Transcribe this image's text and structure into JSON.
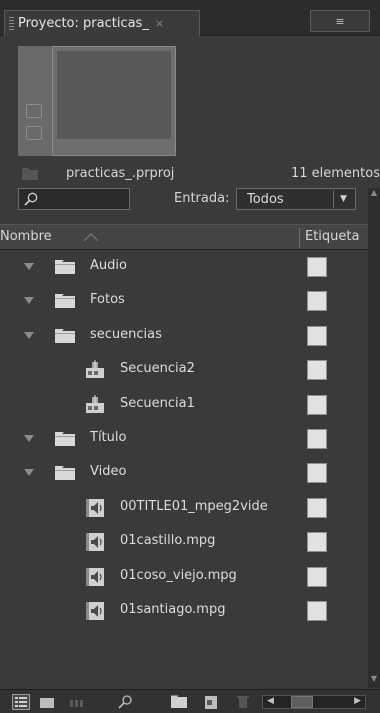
{
  "panel": {
    "tab_title": "Proyecto: practicas_",
    "tab_close": "×",
    "menu_icon": "≡"
  },
  "project": {
    "name": "practicas_.prproj",
    "item_count": "11 elementos"
  },
  "filter": {
    "search_placeholder": "",
    "entrada_label": "Entrada:",
    "entrada_value": "Todos"
  },
  "columns": {
    "name": "Nombre",
    "label": "Etiqueta"
  },
  "items": [
    {
      "type": "folder",
      "label": "Audio"
    },
    {
      "type": "folder",
      "label": "Fotos"
    },
    {
      "type": "folder",
      "label": "secuencias"
    },
    {
      "type": "sequence",
      "label": "Secuencia2"
    },
    {
      "type": "sequence",
      "label": "Secuencia1"
    },
    {
      "type": "folder",
      "label": "Título"
    },
    {
      "type": "folder",
      "label": "Video"
    },
    {
      "type": "clip",
      "label": "00TITLE01_mpeg2vide"
    },
    {
      "type": "clip",
      "label": "01castillo.mpg"
    },
    {
      "type": "clip",
      "label": "01coso_viejo.mpg"
    },
    {
      "type": "clip",
      "label": "01santiago.mpg"
    }
  ],
  "colors": {
    "panel_bg": "#3a3a3a",
    "label_swatch": "#e2e2e2",
    "text": "#dcdcdc"
  }
}
